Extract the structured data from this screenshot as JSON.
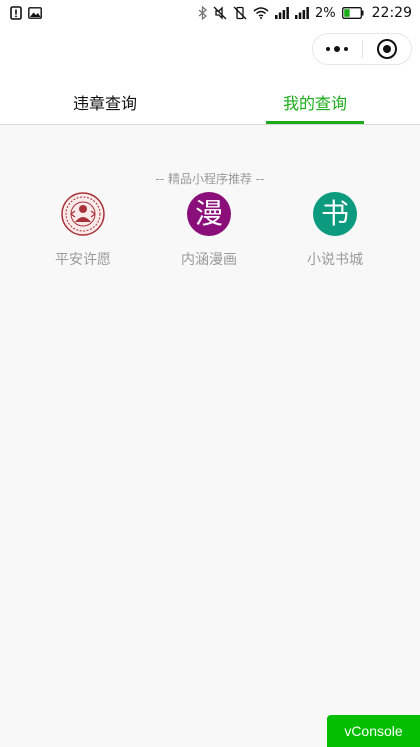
{
  "status_bar": {
    "battery_percent": "2%",
    "time": "22:29"
  },
  "header": {
    "tabs": [
      {
        "label": "违章查询",
        "active": false
      },
      {
        "label": "我的查询",
        "active": true
      }
    ],
    "accent_color": "#1aad19"
  },
  "recommend": {
    "title": "-- 精品小程序推荐 --",
    "apps": [
      {
        "label": "平安许愿",
        "icon": "wish-seal-icon",
        "icon_glyph": ""
      },
      {
        "label": "内涵漫画",
        "icon": "manhua-icon",
        "icon_glyph": "漫",
        "color": "#8b0f7a"
      },
      {
        "label": "小说书城",
        "icon": "novel-book-icon",
        "icon_glyph": "书",
        "color": "#0d9b80"
      }
    ]
  },
  "vconsole": {
    "label": "vConsole"
  }
}
